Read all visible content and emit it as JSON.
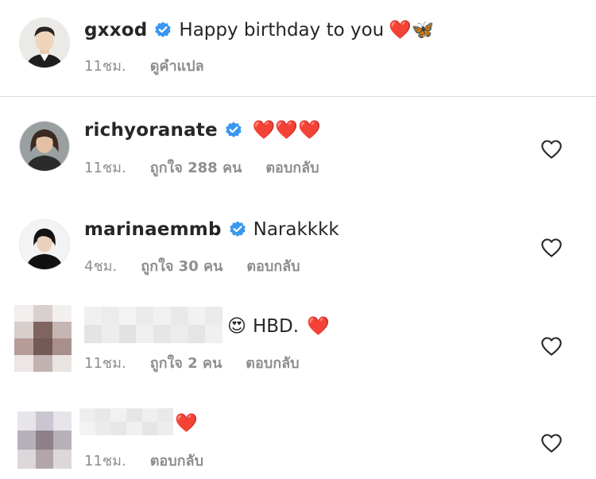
{
  "colors": {
    "verified": "#3897f0",
    "muted": "#8e8e8e",
    "heart_red": "#ed2f3d"
  },
  "top_comment": {
    "username": "gxxod",
    "text": "Happy birthday to you",
    "emojis": "❤️🦋",
    "time": "11ชม.",
    "translate": "ดูคำแปล"
  },
  "replies": [
    {
      "username": "richyoranate",
      "text": "",
      "emojis": "❤️❤️❤️",
      "time": "11ชม.",
      "likes": "ถูกใจ 288 คน",
      "reply": "ตอบกลับ"
    },
    {
      "username": "marinaemmb",
      "text": "Narakkkk",
      "time": "4ชม.",
      "likes": "ถูกใจ 30 คน",
      "reply": "ตอบกลับ"
    },
    {
      "username": "",
      "text": "HBD.",
      "emoji_before": "😍",
      "emojis": "❤️",
      "time": "11ชม.",
      "likes": "ถูกใจ 2 คน",
      "reply": "ตอบกลับ"
    },
    {
      "username": "",
      "text": "",
      "emojis": "❤️",
      "time": "11ชม.",
      "reply": "ตอบกลับ"
    }
  ],
  "icons": {
    "verified": "verified-badge-icon",
    "like": "heart-outline-icon"
  }
}
